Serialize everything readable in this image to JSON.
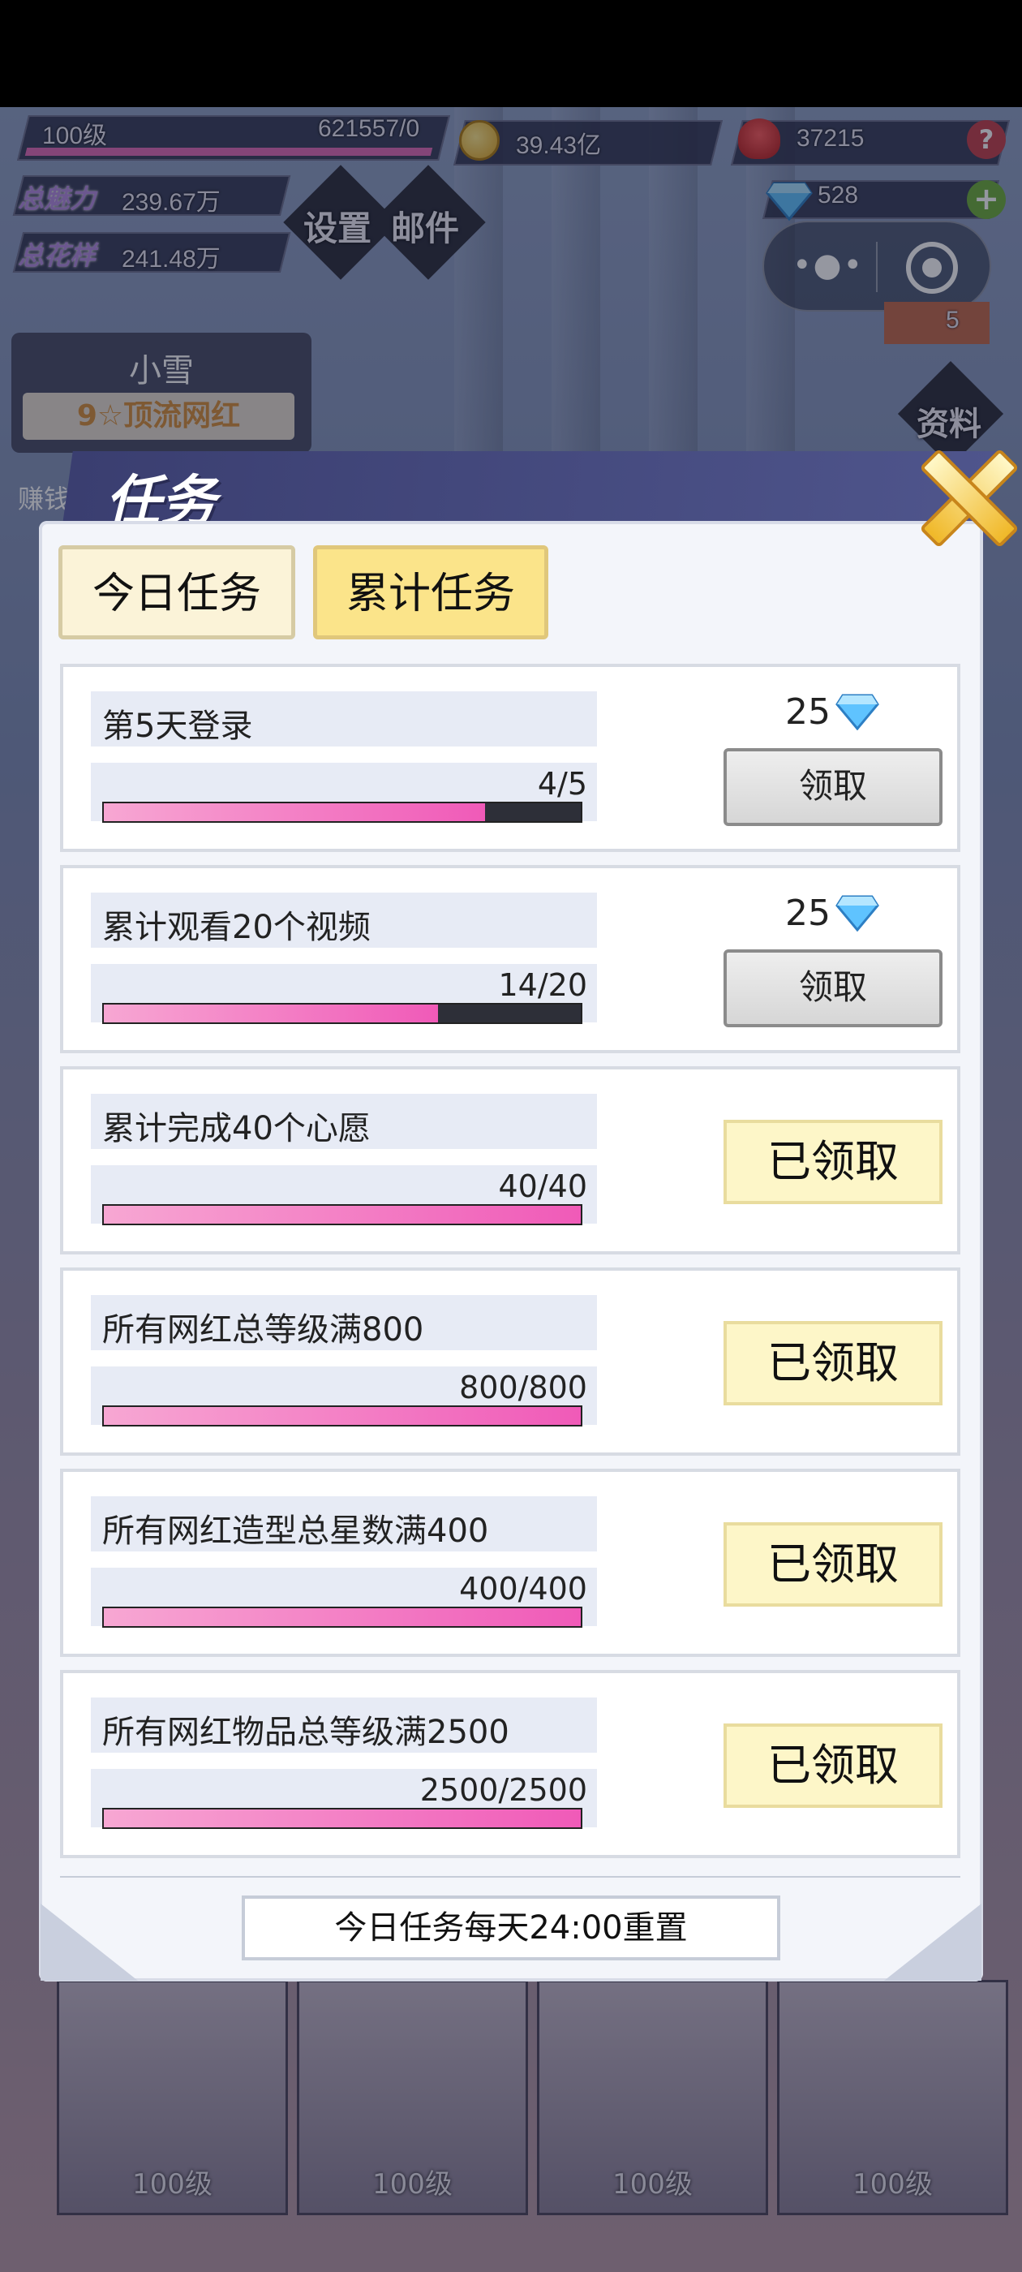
{
  "hud": {
    "level": "100级",
    "exp": "621557/0",
    "gold": "39.43亿",
    "roses": "37215",
    "diamonds": "528",
    "charm_label": "总魅力",
    "charm_value": "239.67万",
    "style_label": "总花样",
    "style_value": "241.48万",
    "settings_label": "设置",
    "mail_label": "邮件",
    "profile_label": "资料",
    "side_badge_num": "5"
  },
  "character": {
    "name": "小雪",
    "rank": "9☆顶流网红",
    "earn_label": "赚钱"
  },
  "panel": {
    "title": "任务",
    "tabs": [
      {
        "label": "今日任务"
      },
      {
        "label": "累计任务"
      }
    ],
    "claim_label": "领取",
    "claimed_label": "已领取",
    "tasks": [
      {
        "name": "第5天登录",
        "progress_text": "4/5",
        "progress": 0.8,
        "reward": "25",
        "status": "claim"
      },
      {
        "name": "累计观看20个视频",
        "progress_text": "14/20",
        "progress": 0.7,
        "reward": "25",
        "status": "claim"
      },
      {
        "name": "累计完成40个心愿",
        "progress_text": "40/40",
        "progress": 1.0,
        "status": "claimed"
      },
      {
        "name": "所有网红总等级满800",
        "progress_text": "800/800",
        "progress": 1.0,
        "status": "claimed"
      },
      {
        "name": "所有网红造型总星数满400",
        "progress_text": "400/400",
        "progress": 1.0,
        "status": "claimed"
      },
      {
        "name": "所有网红物品总等级满2500",
        "progress_text": "2500/2500",
        "progress": 1.0,
        "status": "claimed"
      }
    ],
    "reset_note": "今日任务每天24:00重置"
  },
  "portraits": [
    {
      "level": "100级"
    },
    {
      "level": "100级"
    },
    {
      "level": "100级"
    },
    {
      "level": "100级"
    }
  ],
  "colors": {
    "accent_pink": "#f05ab8",
    "tab_active": "#fbe48a",
    "claimed_bg": "#fdf6c8"
  }
}
